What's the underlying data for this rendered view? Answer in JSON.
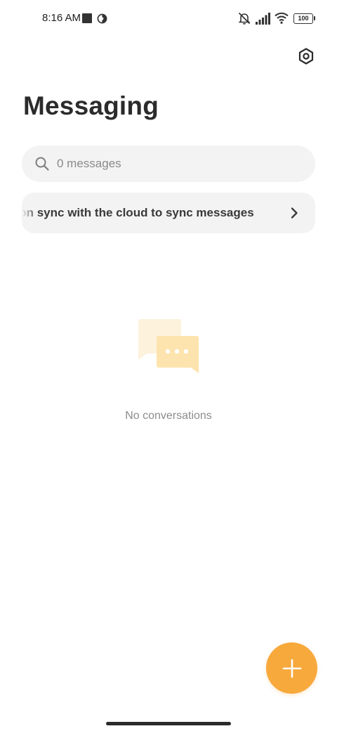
{
  "status_bar": {
    "time": "8:16 AM",
    "battery_level": "100",
    "icons": [
      "square-notification-icon",
      "circle-notification-icon",
      "mute-icon",
      "signal-icon",
      "wifi-icon",
      "battery-icon"
    ]
  },
  "header": {
    "title": "Messaging",
    "settings_icon": "settings-hexagon-icon"
  },
  "search": {
    "placeholder": "0 messages",
    "icon": "search-icon"
  },
  "sync_banner": {
    "text": "Turn on sync with the cloud to sync messages",
    "icon": "chevron-right-icon"
  },
  "empty_state": {
    "text": "No conversations",
    "icon": "chat-bubbles-icon"
  },
  "fab": {
    "icon": "plus-icon"
  },
  "colors": {
    "accent": "#f7a93c",
    "illustration_back": "#fdf2dc",
    "illustration_front": "#fde3ad",
    "surface": "#f3f3f3"
  }
}
